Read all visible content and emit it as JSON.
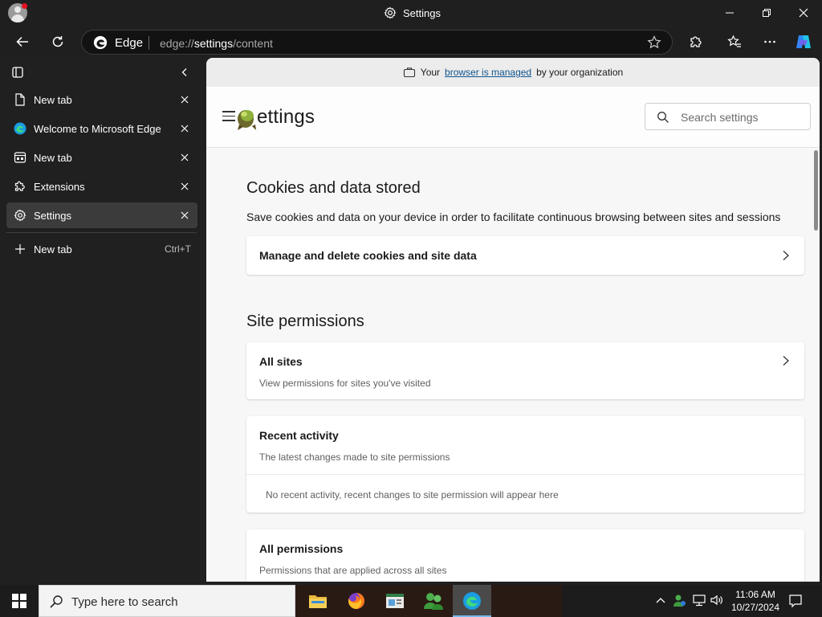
{
  "window": {
    "title": "Settings",
    "controls": {
      "minimize": "minimize",
      "maximize": "maximize",
      "close": "close"
    }
  },
  "toolbar": {
    "browser_label": "Edge",
    "url_prefix": "edge://",
    "url_highlight": "settings",
    "url_suffix": "/content"
  },
  "sidebar": {
    "tabs": [
      {
        "label": "New tab",
        "icon": "page-icon",
        "active": false
      },
      {
        "label": "Welcome to Microsoft Edge",
        "icon": "edge-icon",
        "active": false
      },
      {
        "label": "New tab",
        "icon": "newtab-icon",
        "active": false
      },
      {
        "label": "Extensions",
        "icon": "puzzle-icon",
        "active": false
      },
      {
        "label": "Settings",
        "icon": "gear-icon",
        "active": true
      }
    ],
    "new_tab": {
      "label": "New tab",
      "shortcut": "Ctrl+T"
    }
  },
  "managed_bar": {
    "prefix": "Your",
    "link": "browser is managed",
    "suffix": "by your organization"
  },
  "settings": {
    "title": "ettings",
    "search_placeholder": "Search settings",
    "cookies": {
      "title": "Cookies and data stored",
      "description": "Save cookies and data on your device in order to facilitate continuous browsing between sites and sessions",
      "manage_label": "Manage and delete cookies and site data"
    },
    "site_permissions": {
      "title": "Site permissions",
      "all_sites": {
        "title": "All sites",
        "subtitle": "View permissions for sites you've visited"
      },
      "recent_activity": {
        "title": "Recent activity",
        "subtitle": "The latest changes made to site permissions",
        "note": "No recent activity, recent changes to site permission will appear here"
      },
      "all_permissions": {
        "title": "All permissions",
        "subtitle": "Permissions that are applied across all sites"
      }
    }
  },
  "taskbar": {
    "search_placeholder": "Type here to search",
    "time": "11:06 AM",
    "date": "10/27/2024"
  },
  "colors": {
    "accent_link": "#0f548c",
    "taskbar_active_underline": "#76b9ed",
    "notification_dot": "#e81123"
  }
}
